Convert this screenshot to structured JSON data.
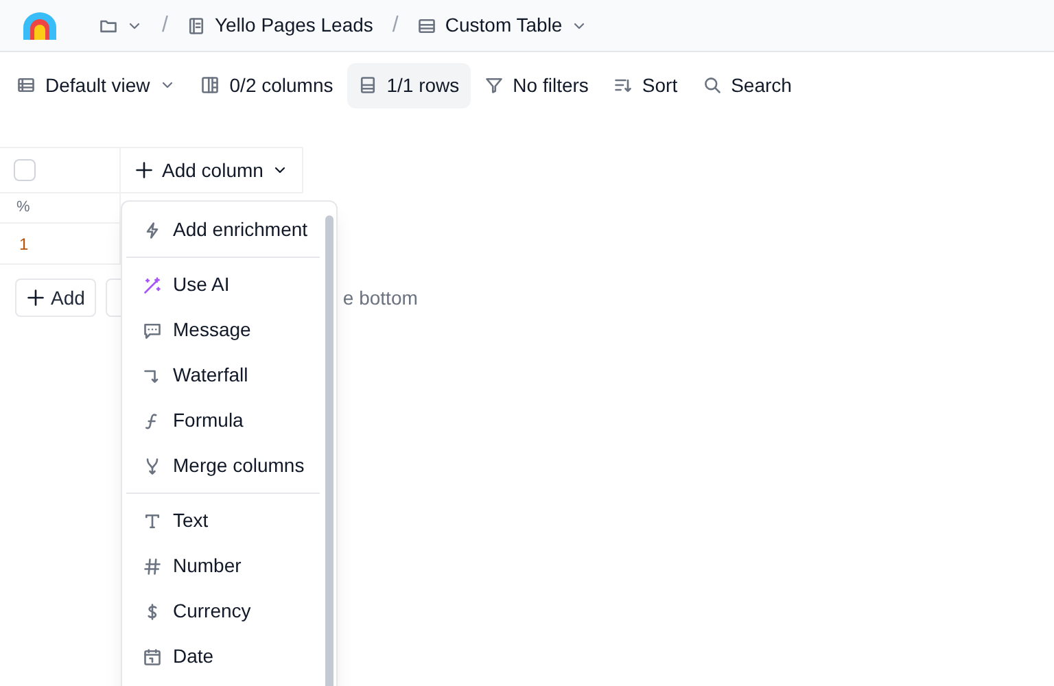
{
  "breadcrumb_separator": "/",
  "breadcrumb": [
    {
      "kind": "folder"
    },
    {
      "kind": "workbook",
      "label": "Yello Pages Leads"
    },
    {
      "kind": "table",
      "label": "Custom Table"
    }
  ],
  "toolbar": [
    {
      "kind": "view",
      "label": "Default view",
      "selected": false
    },
    {
      "kind": "columns",
      "label": "0/2 columns",
      "selected": false
    },
    {
      "kind": "rows",
      "label": "1/1 rows",
      "selected": true
    },
    {
      "kind": "filter",
      "label": "No filters",
      "selected": false
    },
    {
      "kind": "sort",
      "label": "Sort",
      "selected": false
    },
    {
      "kind": "search",
      "label": "Search",
      "selected": false
    }
  ],
  "table": {
    "select_all_checked": false,
    "add_column": "Add column",
    "column_1_sub": "%",
    "rows": [
      {
        "index": "1"
      }
    ]
  },
  "footer": {
    "add_button": "Add",
    "hint": "e bottom"
  },
  "menu": {
    "sections": [
      [
        {
          "kind": "enrichment",
          "label": "Add enrichment"
        }
      ],
      [
        {
          "kind": "ai",
          "label": "Use AI"
        },
        {
          "kind": "message",
          "label": "Message"
        },
        {
          "kind": "waterfall",
          "label": "Waterfall"
        },
        {
          "kind": "formula",
          "label": "Formula"
        },
        {
          "kind": "merge",
          "label": "Merge columns"
        }
      ],
      [
        {
          "kind": "text",
          "label": "Text"
        },
        {
          "kind": "number",
          "label": "Number"
        },
        {
          "kind": "currency",
          "label": "Currency"
        },
        {
          "kind": "date",
          "label": "Date"
        }
      ]
    ]
  }
}
